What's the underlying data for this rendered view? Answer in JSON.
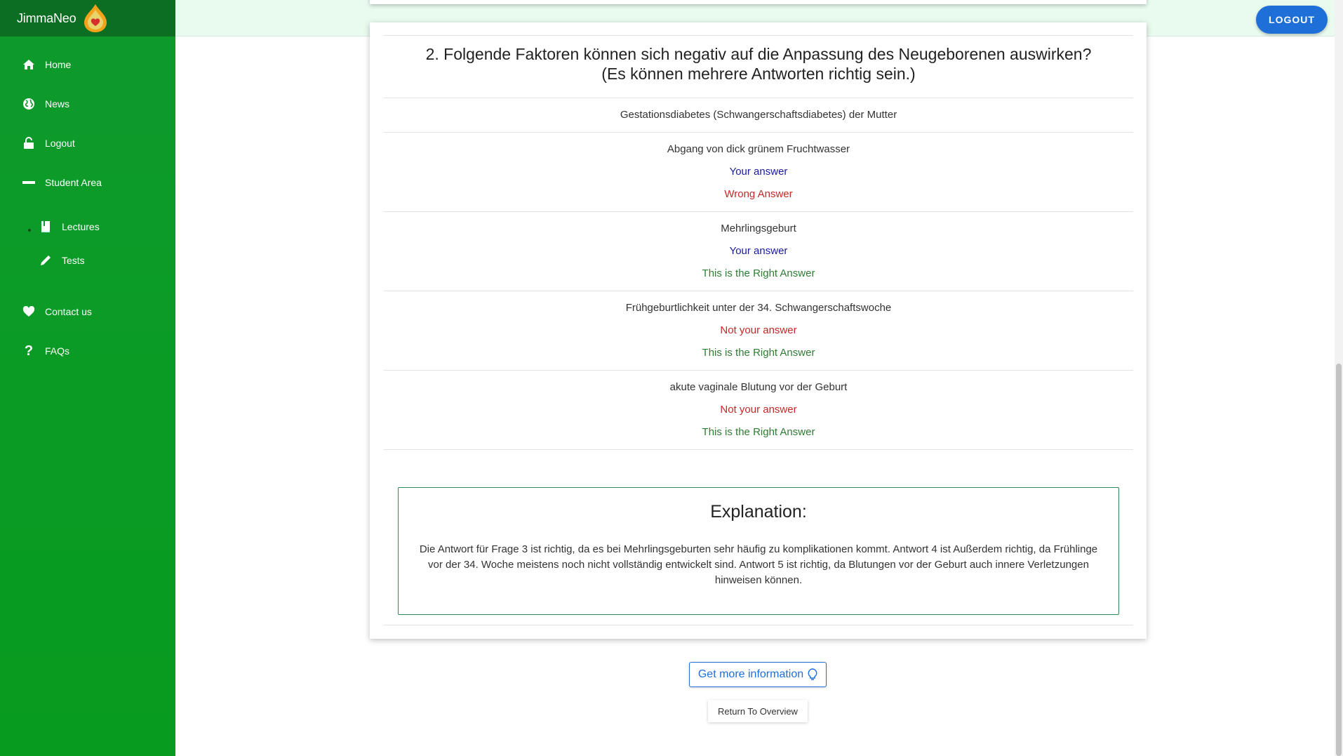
{
  "brand": {
    "name": "JimmaNeo"
  },
  "sidebar": {
    "items": [
      {
        "label": "Home",
        "icon": "home-icon"
      },
      {
        "label": "News",
        "icon": "globe-icon"
      },
      {
        "label": "Logout",
        "icon": "lock-icon"
      },
      {
        "label": "Student Area",
        "icon": "minus-icon"
      },
      {
        "label": "Lectures",
        "icon": "book-icon"
      },
      {
        "label": "Tests",
        "icon": "pencil-icon"
      },
      {
        "label": "Contact us",
        "icon": "heart-icon"
      },
      {
        "label": "FAQs",
        "icon": "question-icon"
      }
    ]
  },
  "header": {
    "logout_label": "LOGOUT"
  },
  "question": {
    "title_line1": "2. Folgende Faktoren können sich negativ auf die Anpassung des Neugeborenen auswirken?",
    "title_line2": "(Es können mehrere Antworten richtig sein.)",
    "answers": [
      {
        "text": "Gestationsdiabetes (Schwangerschaftsdiabetes) der Mutter"
      },
      {
        "text": "Abgang von dick grünem Fruchtwasser",
        "selection": "Your answer",
        "verdict": "Wrong Answer"
      },
      {
        "text": "Mehrlingsgeburt",
        "selection": "Your answer",
        "verdict": "This is the Right Answer"
      },
      {
        "text": "Frühgeburtlichkeit unter der 34. Schwangerschaftswoche",
        "selection": "Not your answer",
        "verdict": "This is the Right Answer"
      },
      {
        "text": "akute vaginale Blutung vor der Geburt",
        "selection": "Not your answer",
        "verdict": "This is the Right Answer"
      }
    ]
  },
  "explanation": {
    "heading": "Explanation:",
    "text": "Die Antwort für Frage 3 ist richtig, da es bei Mehrlingsgeburten sehr häufig zu komplikationen kommt. Antwort 4 ist Außerdem richtig, da Frühlinge vor der 34. Woche meistens noch nicht vollständig entwickelt sind. Antwort 5 ist richtig, da Blutungen vor der Geburt auch innere Verletzungen hinweisen können."
  },
  "actions": {
    "more_info_label": "Get more information",
    "return_label": "Return To Overview"
  },
  "colors": {
    "sidebar": "#0a9b25",
    "brand_bar": "#0b6e22",
    "accent": "#1e6fd8",
    "right": "#2e7d32",
    "wrong": "#c62828",
    "your_answer": "#1b1ba0"
  }
}
